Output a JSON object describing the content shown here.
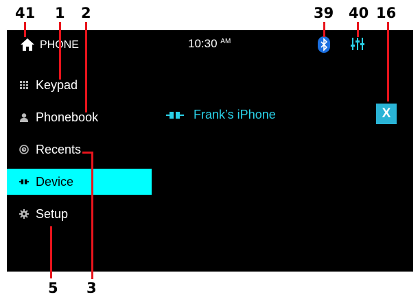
{
  "callouts": {
    "c41": "41",
    "c1": "1",
    "c2": "2",
    "c39": "39",
    "c40": "40",
    "c16": "16",
    "c5": "5",
    "c3": "3"
  },
  "topbar": {
    "title": "PHONE",
    "time": "10:30",
    "ampm": "AM"
  },
  "menu": {
    "keypad": "Keypad",
    "phonebook": "Phonebook",
    "recents": "Recents",
    "device": "Device",
    "setup": "Setup"
  },
  "main": {
    "device_name": "Frank’s iPhone",
    "close_label": "X"
  },
  "colors": {
    "accent_cyan": "#00ffff",
    "device_text": "#2ad1e8",
    "callout_line": "#e8141c",
    "bluetooth_badge": "#1b6fe0"
  },
  "icons": [
    "home-icon",
    "keypad-icon",
    "person-icon",
    "recents-icon",
    "device-connect-icon",
    "gear-icon",
    "bluetooth-icon",
    "equalizer-icon"
  ]
}
